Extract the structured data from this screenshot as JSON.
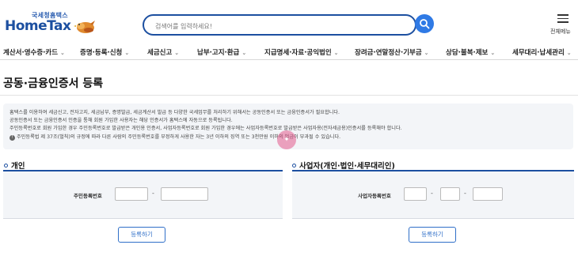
{
  "header": {
    "logo_top": "국세청홈택스",
    "logo_main": "HomeTax",
    "search_placeholder": "검색어를 입력하세요!",
    "menu_label": "전체메뉴"
  },
  "nav": {
    "items": [
      {
        "label": "계산서·영수증·카드"
      },
      {
        "label": "증명·등록·신청"
      },
      {
        "label": "세금신고"
      },
      {
        "label": "납부·고지·환급"
      },
      {
        "label": "지급명세·자료·공익법인"
      },
      {
        "label": "장려금·연말정산·기부금"
      },
      {
        "label": "상담·불복·제보"
      },
      {
        "label": "세무대리·납세관리"
      }
    ]
  },
  "page": {
    "title": "공동·금융인증서 등록"
  },
  "info": {
    "line1": "홈택스를 이용하여 세금신고, 전자고지, 세금납부, 증명발급, 세금계산서 발급 등 다양한 국세업무를 처리하기 위해서는 공동인증서 또는 금융인증서가 필요합니다.",
    "line2": "공동인증서 또는 금융인증서 인증을 통해 회원 가입한 사용자는 해당 인증서가 홈택스에 자동으로 등록됩니다.",
    "line3": "주민등록번호로 회원 가입한 경우 주민등록번호로 발급받은 개인용 인증서, 사업자등록번호로 회원 가입한 경우에는 사업자등록번호로 발급받은 사업자용(전자세금용)인증서를 등록해야 합니다.",
    "line4": "주민등록법 제 37조(벌칙)의 규정에 따라 다른 사람의 주민등록번호를 부정하게 사용한 자는 3년 이하의 징역 또는 3천만원 이하의 벌금이 부과될 수 있습니다."
  },
  "personal": {
    "title": "개인",
    "field_label": "주민등록번호",
    "dash": "-",
    "button": "등록하기"
  },
  "business": {
    "title": "사업자(개인·법인·세무대리인)",
    "field_label": "사업자등록번호",
    "dash": "-",
    "button": "등록하기"
  },
  "colors": {
    "brand": "#1c4fa0",
    "search_button": "#2f7ae5",
    "panel_bg": "#f3f5f8"
  }
}
